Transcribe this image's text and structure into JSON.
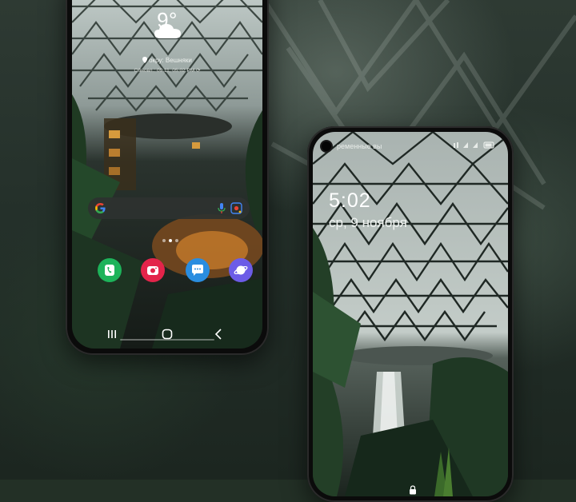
{
  "left_phone": {
    "weather": {
      "temperature": "9°",
      "location": "окру: Вешняки",
      "updated": "Обновл.: 09.11, 05:02 PM ⟳",
      "condition_icon": "cloud-icon"
    },
    "search_bar": {
      "left_icon": "google-g-icon",
      "mic_icon": "mic-icon",
      "lens_icon": "lens-icon"
    },
    "dock_apps": [
      {
        "name": "Phone",
        "icon": "phone-icon",
        "color": "#1db35a"
      },
      {
        "name": "Camera",
        "icon": "camera-icon",
        "color": "#e3244a"
      },
      {
        "name": "Messages",
        "icon": "message-icon",
        "color": "#2a8de0"
      },
      {
        "name": "Internet",
        "icon": "planet-icon",
        "color": "#6c5ce7"
      }
    ],
    "navigation": [
      "recent-apps-icon",
      "home-icon",
      "back-icon"
    ]
  },
  "right_phone": {
    "status_bar_left": "ременные вы",
    "lock_screen": {
      "time": "5:02",
      "date": "ср, 9 ноября"
    },
    "bottom_icon": "lock-icon"
  },
  "colors": {
    "background": "#233026",
    "phone_frame": "#0b0b0b",
    "search_bar": "#2e3230"
  }
}
